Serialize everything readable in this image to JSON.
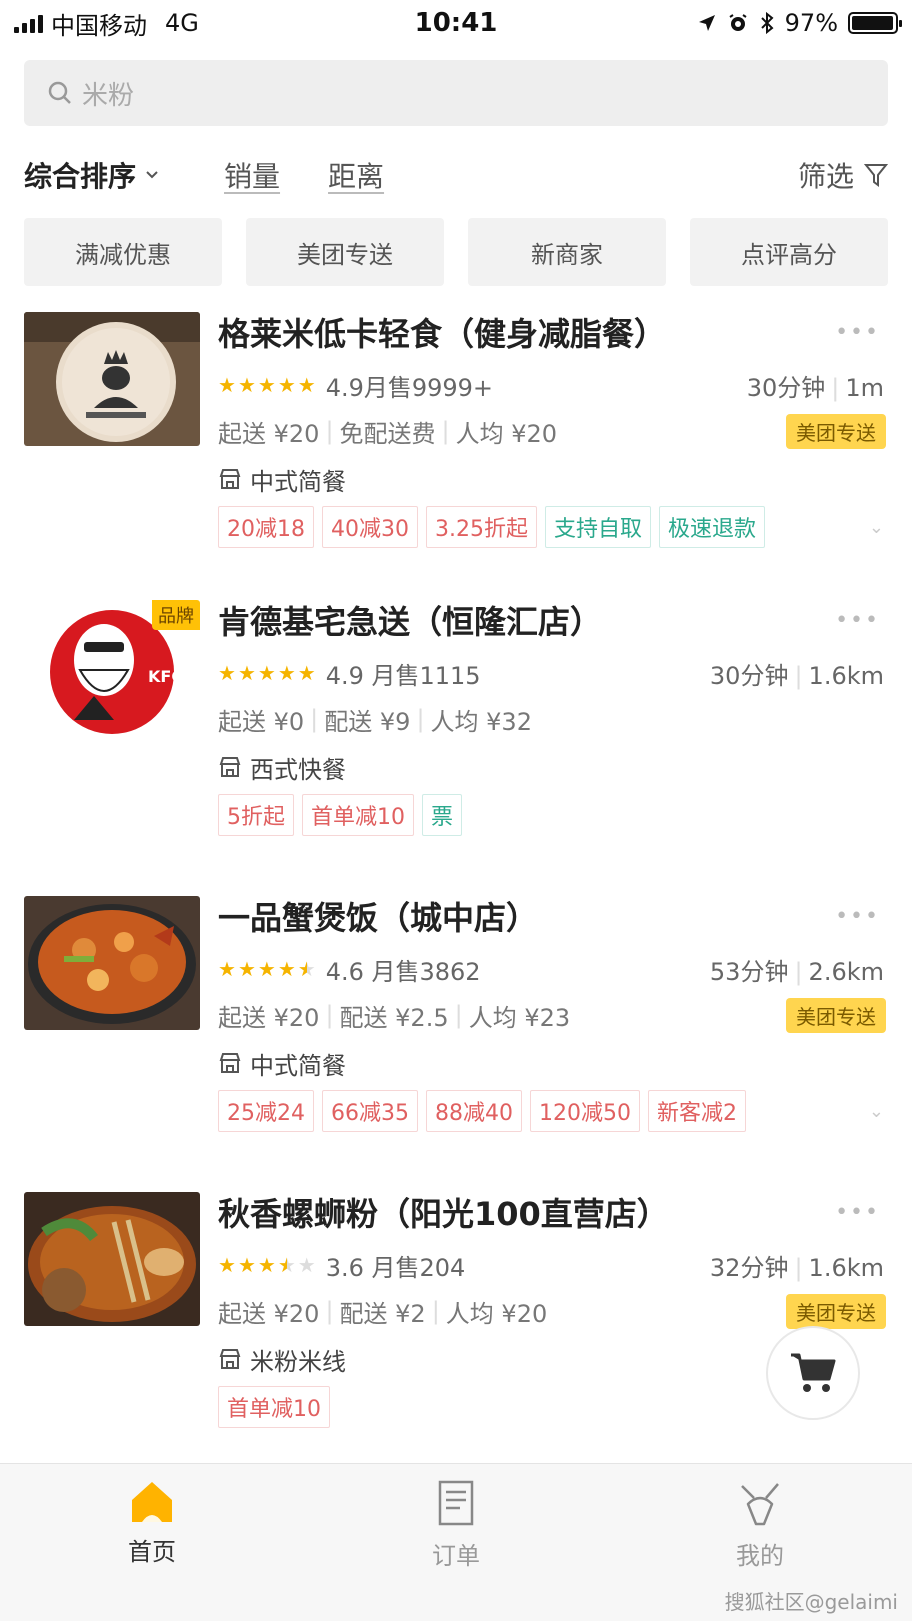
{
  "status": {
    "carrier": "中国移动",
    "network": "4G",
    "time": "10:41",
    "battery": "97%",
    "battery_level": 0.97
  },
  "search": {
    "placeholder": "米粉"
  },
  "sort": {
    "main": "综合排序",
    "sales": "销量",
    "distance": "距离",
    "filter": "筛选"
  },
  "chips": [
    "满减优惠",
    "美团专送",
    "新商家",
    "点评高分"
  ],
  "shops": [
    {
      "name": "格莱米低卡轻食（健身减脂餐）",
      "stars": 5,
      "rating_sales": "4.9月售9999+",
      "time": "30分钟",
      "distance": "1m",
      "min_order": "起送 ¥20",
      "delivery": "免配送费",
      "avg": "人均 ¥20",
      "badge": "美团专送",
      "category": "中式简餐",
      "tags": [
        "20减18",
        "40减30",
        "3.25折起",
        "支持自取",
        "极速退款"
      ],
      "expand": "⌄"
    },
    {
      "name": "肯德基宅急送（恒隆汇店）",
      "stars": 5,
      "rating_sales": "4.9 月售1115",
      "time": "30分钟",
      "distance": "1.6km",
      "min_order": "起送 ¥0",
      "delivery": "配送 ¥9",
      "avg": "人均 ¥32",
      "brand": "品牌",
      "category": "西式快餐",
      "tags": [
        "5折起",
        "首单减10",
        "票"
      ]
    },
    {
      "name": "一品蟹煲饭（城中店）",
      "stars": 4.5,
      "rating_sales": "4.6  月售3862",
      "time": "53分钟",
      "distance": "2.6km",
      "min_order": "起送 ¥20",
      "delivery": "配送 ¥2.5",
      "avg": "人均 ¥23",
      "badge": "美团专送",
      "category": "中式简餐",
      "tags": [
        "25减24",
        "66减35",
        "88减40",
        "120减50",
        "新客减2"
      ],
      "expand": "⌄"
    },
    {
      "name": "秋香螺蛳粉（阳光100直营店）",
      "stars": 3.5,
      "rating_sales": "3.6  月售204",
      "time": "32分钟",
      "distance": "1.6km",
      "min_order": "起送 ¥20",
      "delivery": "配送 ¥2",
      "avg": "人均 ¥20",
      "badge": "美团专送",
      "category": "米粉米线",
      "tags": [
        "首单减10"
      ]
    }
  ],
  "tabs": [
    {
      "label": "首页",
      "icon": "home-icon"
    },
    {
      "label": "订单",
      "icon": "order-icon"
    },
    {
      "label": "我的",
      "icon": "profile-icon"
    }
  ],
  "watermark": "搜狐社区@gelaimi",
  "colors": {
    "accent": "#ffc107",
    "tag_red": "#e06060",
    "tag_green": "#2aa88c"
  }
}
